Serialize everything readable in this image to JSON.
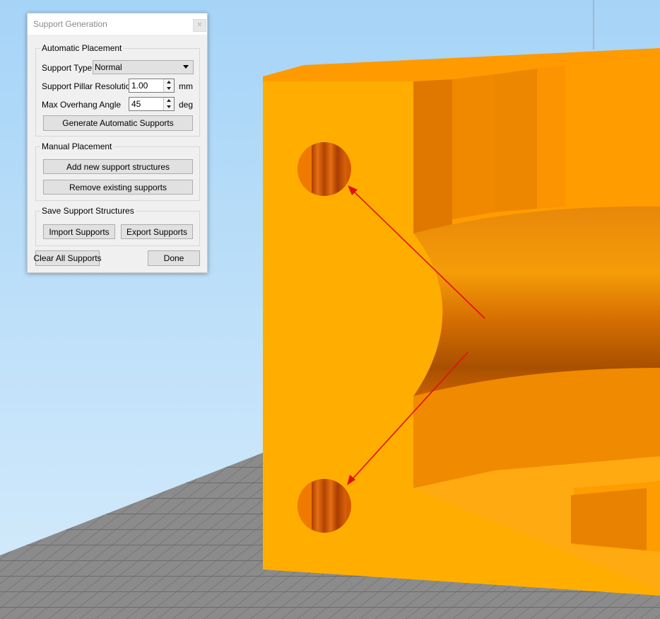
{
  "dialog": {
    "title": "Support Generation",
    "close_icon": "close-icon",
    "automatic": {
      "group_title": "Automatic Placement",
      "support_type_label": "Support Type",
      "support_type_value": "Normal",
      "pillar_resolution_label": "Support Pillar Resolution",
      "pillar_resolution_value": "1.00",
      "pillar_resolution_unit": "mm",
      "overhang_label": "Max Overhang Angle",
      "overhang_value": "45",
      "overhang_unit": "deg",
      "generate_button": "Generate Automatic Supports"
    },
    "manual": {
      "group_title": "Manual Placement",
      "add_button": "Add new support structures",
      "remove_button": "Remove existing supports"
    },
    "save": {
      "group_title": "Save Support Structures",
      "import_button": "Import Supports",
      "export_button": "Export Supports"
    },
    "clear_button": "Clear All Supports",
    "done_button": "Done"
  },
  "scene": {
    "background_color": "#b8dcf8",
    "model_color": "#ffa800",
    "grid_color": "#8c8c8c",
    "annotation_arrow_color": "#e01010"
  }
}
